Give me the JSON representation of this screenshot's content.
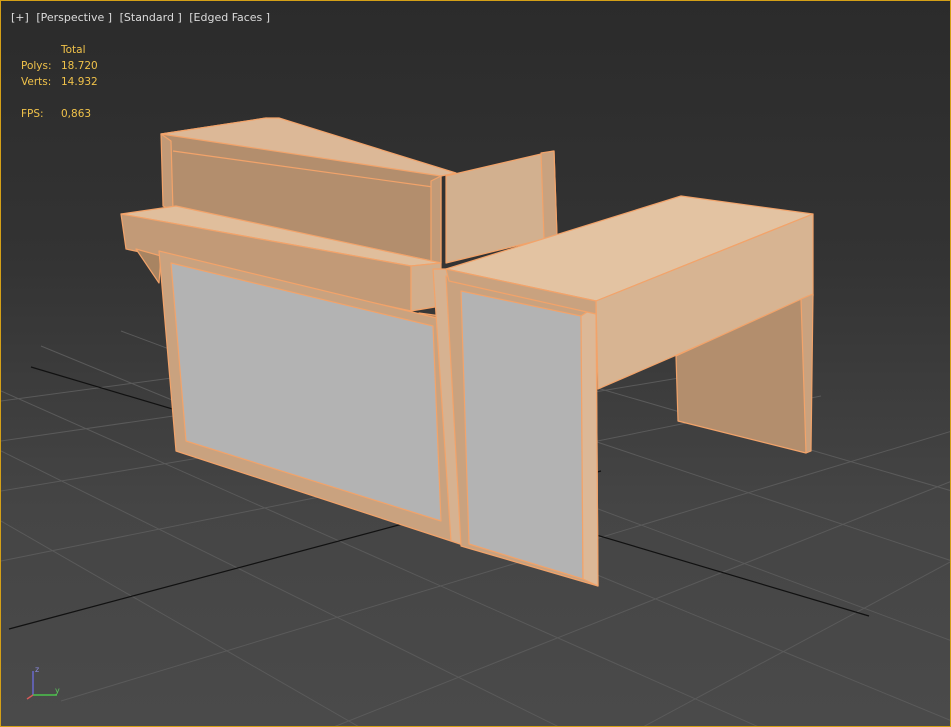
{
  "viewport": {
    "labels": [
      "[+]",
      "[Perspective ]",
      "[Standard ]",
      "[Edged Faces ]"
    ],
    "stats": {
      "header": "Total",
      "polys_label": "Polys:",
      "polys_value": "18.720",
      "verts_label": "Verts:",
      "verts_value": "14.932",
      "fps_label": "FPS:",
      "fps_value": "0,863"
    },
    "gizmo": {
      "z": "z",
      "y": "y"
    }
  },
  "colors": {
    "accent": "#d4a017",
    "stats_text": "#f0c24a",
    "wood": "#c9a27f",
    "edge": "#f2a36a",
    "panel": "#b3b3b3"
  }
}
